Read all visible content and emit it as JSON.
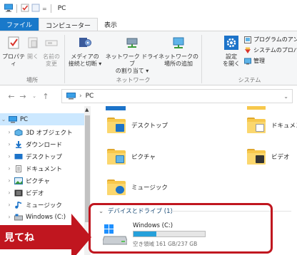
{
  "window": {
    "title": "PC"
  },
  "tabs": {
    "file": "ファイル",
    "computer": "コンピューター",
    "view": "表示"
  },
  "ribbon": {
    "properties": "プロパティ",
    "open": "開く",
    "rename_1": "名前の",
    "rename_2": "変更",
    "location_group": "場所",
    "media_1": "メディアの",
    "media_2": "接続と切断 ▾",
    "netdrive_1": "ネットワーク ドライブ",
    "netdrive_2": "の割り当て ▾",
    "netloc_1": "ネットワークの",
    "netloc_2": "場所の追加",
    "network_group": "ネットワーク",
    "settings_1": "設定",
    "settings_2": "を開く",
    "programs": "プログラムのアン",
    "sysprops": "システムのプロパ",
    "manage": "管理",
    "system_group": "システム"
  },
  "address": {
    "path": "PC"
  },
  "tree": {
    "pc": "PC",
    "objects3d": "3D オブジェクト",
    "downloads": "ダウンロード",
    "desktop": "デスクトップ",
    "documents": "ドキュメント",
    "pictures": "ピクチャ",
    "videos": "ビデオ",
    "music": "ミュージック",
    "windows_c": "Windows (C:)"
  },
  "folders": {
    "desktop": "デスクトップ",
    "documents": "ドキュメント",
    "pictures": "ピクチャ",
    "videos": "ビデオ",
    "music": "ミュージック"
  },
  "devices": {
    "header": "デバイスとドライブ (1)",
    "drive_name": "Windows (C:)",
    "drive_info": "空き領域 161 GB/237 GB",
    "used_fraction": 0.32
  },
  "callout": {
    "text": "見てね"
  },
  "colors": {
    "accent": "#1979ca",
    "highlight": "#c0161f",
    "drive_fill": "#26a0da"
  }
}
